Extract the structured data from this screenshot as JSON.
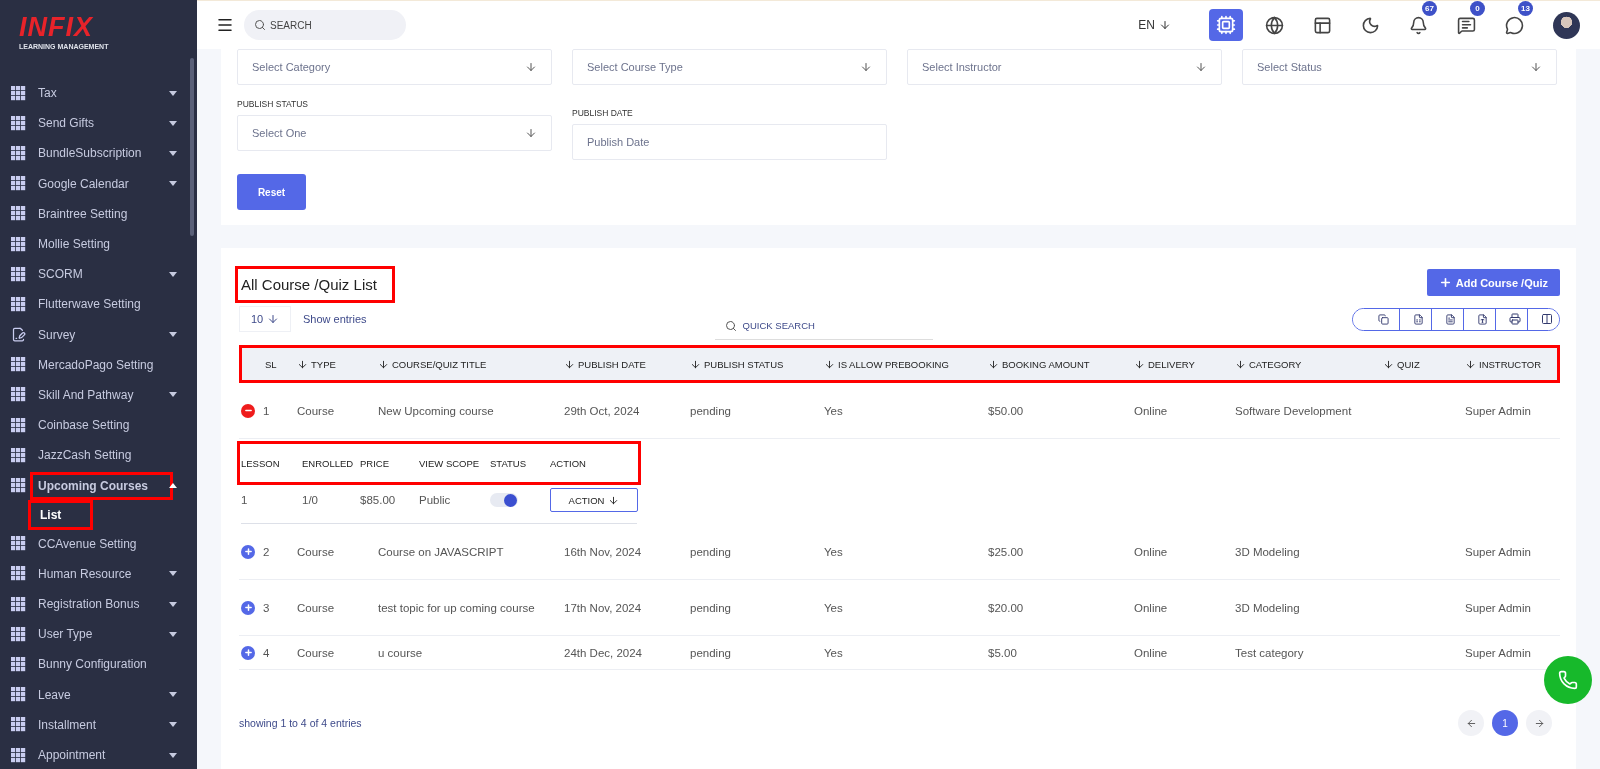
{
  "logo": {
    "brand": "INFIX",
    "tagline": "LEARNING MANAGEMENT"
  },
  "sidebar": {
    "items": [
      {
        "label": "Tax",
        "kind": "grid",
        "expanded": false
      },
      {
        "label": "Send Gifts",
        "kind": "grid",
        "expanded": false
      },
      {
        "label": "BundleSubscription",
        "kind": "grid",
        "expanded": false
      },
      {
        "label": "Google Calendar",
        "kind": "grid",
        "expanded": false
      },
      {
        "label": "Braintree Setting",
        "kind": "grid"
      },
      {
        "label": "Mollie Setting",
        "kind": "grid"
      },
      {
        "label": "SCORM",
        "kind": "grid",
        "expanded": false
      },
      {
        "label": "Flutterwave Setting",
        "kind": "grid"
      },
      {
        "label": "Survey",
        "kind": "form",
        "expanded": false
      },
      {
        "label": "MercadoPago Setting",
        "kind": "grid"
      },
      {
        "label": "Skill And Pathway",
        "kind": "grid",
        "expanded": false
      },
      {
        "label": "Coinbase Setting",
        "kind": "grid"
      },
      {
        "label": "JazzCash Setting",
        "kind": "grid"
      },
      {
        "label": "Upcoming Courses",
        "kind": "grid",
        "expanded": true,
        "highlighted": true,
        "children": [
          {
            "label": "List",
            "selected": true,
            "highlighted": true
          }
        ]
      },
      {
        "label": "CCAvenue Setting",
        "kind": "grid"
      },
      {
        "label": "Human Resource",
        "kind": "grid",
        "expanded": false
      },
      {
        "label": "Registration Bonus",
        "kind": "grid",
        "expanded": false
      },
      {
        "label": "User Type",
        "kind": "grid",
        "expanded": false
      },
      {
        "label": "Bunny Configuration",
        "kind": "grid"
      },
      {
        "label": "Leave",
        "kind": "grid",
        "expanded": false
      },
      {
        "label": "Installment",
        "kind": "grid",
        "expanded": false
      },
      {
        "label": "Appointment",
        "kind": "grid",
        "expanded": false
      }
    ]
  },
  "topbar": {
    "search_placeholder": "SEARCH",
    "language": "EN",
    "badges": {
      "notifications": "67",
      "messages": "0",
      "whatsapp": "13"
    }
  },
  "filters": {
    "top_selects": [
      "Select Category",
      "Select Course Type",
      "Select Instructor",
      "Select Status"
    ],
    "publish_status": {
      "label": "PUBLISH STATUS",
      "value": "Select One"
    },
    "publish_date": {
      "label": "PUBLISH DATE",
      "placeholder": "Publish Date"
    },
    "reset_button": "Reset"
  },
  "list": {
    "title": "All Course /Quiz List",
    "title_highlighted": true,
    "add_button": "Add Course /Quiz",
    "page_size": "10",
    "show_entries": "Show entries",
    "search_placeholder": "QUICK SEARCH",
    "columns": [
      {
        "label": "SL",
        "sortable": false
      },
      {
        "label": "TYPE",
        "sortable": true
      },
      {
        "label": "COURSE/QUIZ TITLE",
        "sortable": true
      },
      {
        "label": "PUBLISH DATE",
        "sortable": true
      },
      {
        "label": "PUBLISH STATUS",
        "sortable": true
      },
      {
        "label": "IS ALLOW PREBOOKING",
        "sortable": true
      },
      {
        "label": "BOOKING AMOUNT",
        "sortable": true
      },
      {
        "label": "DELIVERY",
        "sortable": true
      },
      {
        "label": "CATEGORY",
        "sortable": true
      },
      {
        "label": "QUIZ",
        "sortable": true
      },
      {
        "label": "INSTRUCTOR",
        "sortable": true
      }
    ],
    "header_highlighted": true,
    "rows": [
      {
        "expanded": true,
        "cells": [
          "1",
          "Course",
          "New Upcoming course",
          "29th Oct, 2024",
          "pending",
          "Yes",
          "$50.00",
          "Online",
          "Software Development",
          "",
          "Super Admin"
        ],
        "details": {
          "highlighted": true,
          "columns": [
            "LESSON",
            "ENROLLED",
            "PRICE",
            "VIEW SCOPE",
            "STATUS",
            "ACTION"
          ],
          "values": [
            "1",
            "1/0",
            "$85.00",
            "Public"
          ],
          "status_on": true,
          "action_button": "ACTION"
        }
      },
      {
        "expanded": false,
        "cells": [
          "2",
          "Course",
          "Course on JAVASCRIPT",
          "16th Nov, 2024",
          "pending",
          "Yes",
          "$25.00",
          "Online",
          "3D Modeling",
          "",
          "Super Admin"
        ]
      },
      {
        "expanded": false,
        "cells": [
          "3",
          "Course",
          "test topic for up coming course",
          "17th Nov, 2024",
          "pending",
          "Yes",
          "$20.00",
          "Online",
          "3D Modeling",
          "",
          "Super Admin"
        ]
      },
      {
        "expanded": false,
        "cells": [
          "4",
          "Course",
          "u course",
          "24th Dec, 2024",
          "pending",
          "Yes",
          "$5.00",
          "Online",
          "Test category",
          "",
          "Super Admin"
        ]
      }
    ],
    "footer": "showing 1 to 4 of 4 entries",
    "pages": [
      {
        "label": "1",
        "selected": true
      }
    ]
  }
}
